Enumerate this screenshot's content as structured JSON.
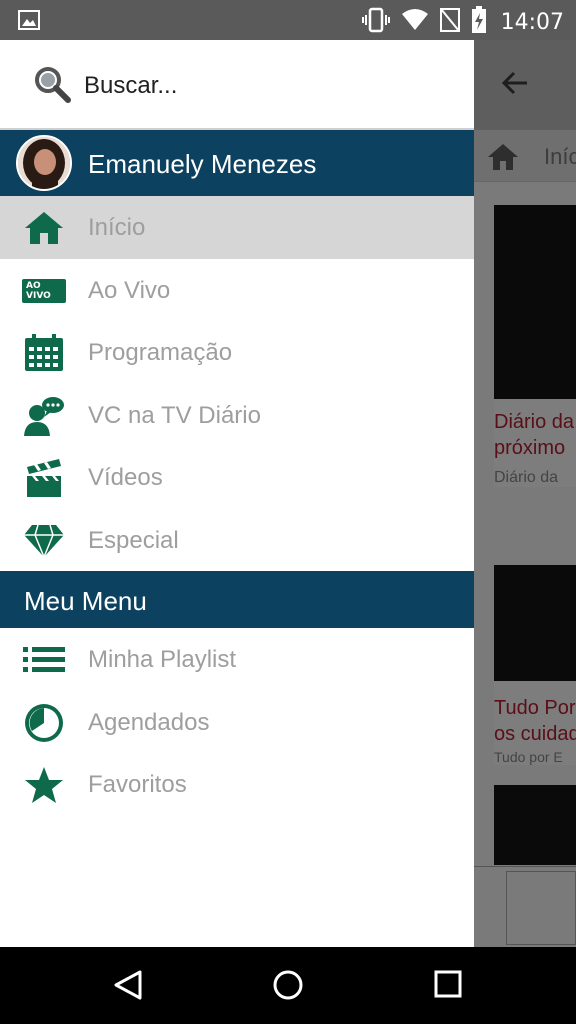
{
  "status_bar": {
    "time": "14:07"
  },
  "drawer": {
    "search": {
      "placeholder": "Buscar..."
    },
    "profile": {
      "name": "Emanuely Menezes"
    },
    "items": [
      {
        "label": "Início",
        "icon": "home-icon",
        "active": true
      },
      {
        "label": "Ao Vivo",
        "icon": "ao-vivo-icon",
        "badge": "AO VIVO"
      },
      {
        "label": "Programação",
        "icon": "calendar-icon"
      },
      {
        "label": "VC na TV Diário",
        "icon": "chat-person-icon"
      },
      {
        "label": "Vídeos",
        "icon": "clapperboard-icon"
      },
      {
        "label": "Especial",
        "icon": "diamond-icon"
      }
    ],
    "section_title": "Meu Menu",
    "my_items": [
      {
        "label": "Minha Playlist",
        "icon": "list-icon"
      },
      {
        "label": "Agendados",
        "icon": "clock-icon"
      },
      {
        "label": "Favoritos",
        "icon": "star-icon"
      }
    ]
  },
  "background": {
    "tab_label": "Iníc",
    "cards": [
      {
        "title_line1": "Diário da",
        "title_line2": "próximo",
        "subtitle": "Diário da"
      },
      {
        "title_line1": "Tudo Por",
        "title_line2": "os cuidad",
        "subtitle": "Tudo por E"
      }
    ]
  },
  "colors": {
    "brand_green": "#0e6a4a",
    "header_blue": "#0c4260",
    "label_gray": "#9e9e9e",
    "active_bg": "#d6d6d6"
  }
}
